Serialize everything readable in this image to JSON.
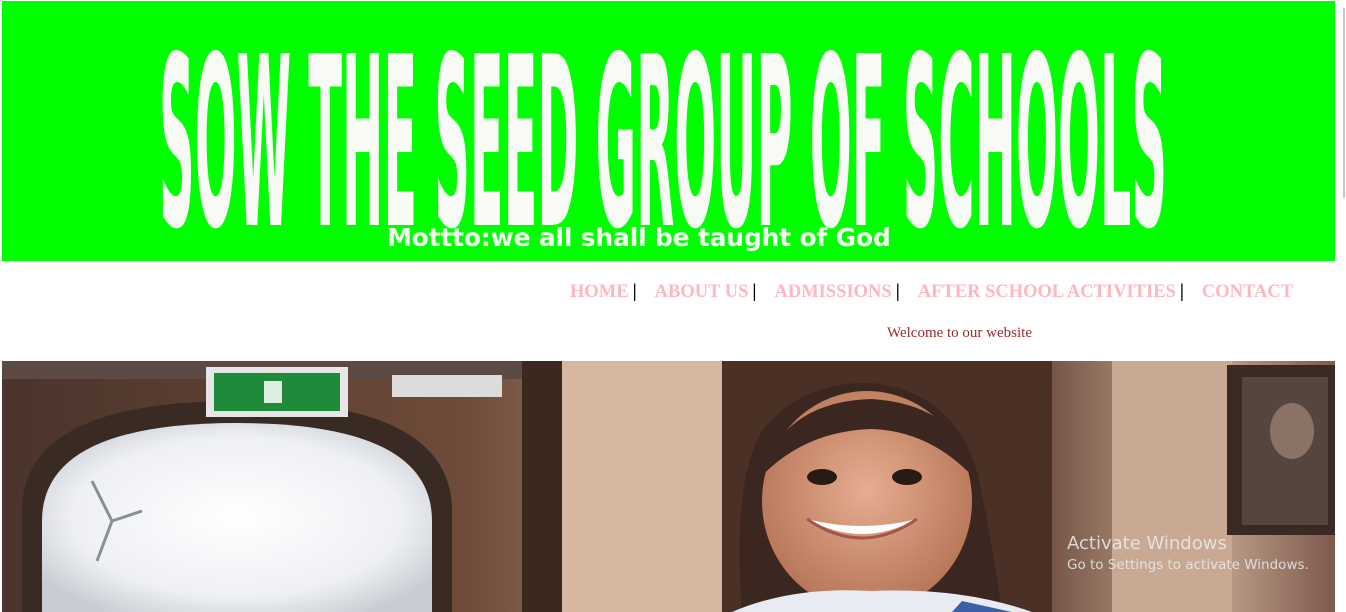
{
  "banner": {
    "title": "SOW THE SEED GROUP OF SCHOOLS",
    "motto": "Mottto:we all shall be taught of God",
    "bg_color": "#00ff00"
  },
  "nav": {
    "items": [
      {
        "label": "HOME"
      },
      {
        "label": "ABOUT US"
      },
      {
        "label": "ADMISSIONS"
      },
      {
        "label": "AFTER SCHOOL ACTIVITIES"
      },
      {
        "label": "CONTACT"
      }
    ],
    "separator": "|",
    "link_color": "#ffb6c1"
  },
  "welcome": "Welcome to our website",
  "hero": {
    "exit_sign_icon": "exit-sign-icon"
  },
  "watermark": {
    "title": "Activate Windows",
    "subtitle": "Go to Settings to activate Windows."
  }
}
